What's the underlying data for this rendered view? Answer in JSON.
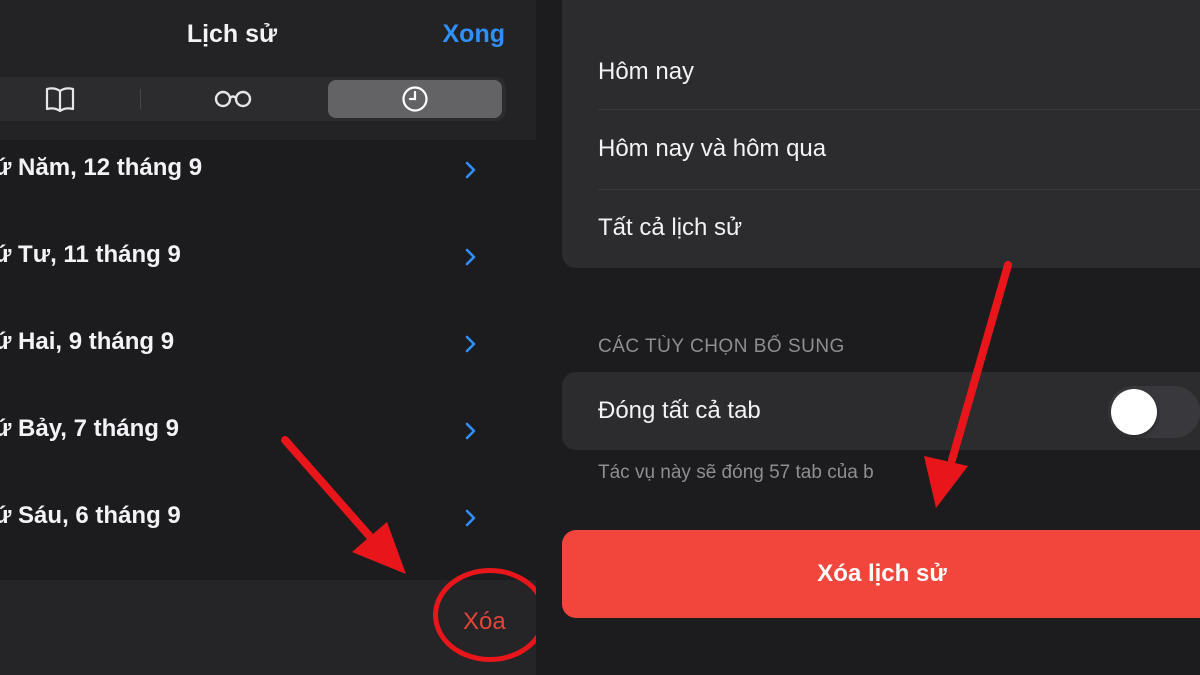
{
  "left_panel": {
    "title": "Lịch sử",
    "done_label": "Xong",
    "segments": [
      {
        "icon": "book-icon",
        "selected": false
      },
      {
        "icon": "reading-glasses-icon",
        "selected": false
      },
      {
        "icon": "clock-icon",
        "selected": true
      }
    ],
    "history_days": [
      {
        "label": "ứ Năm, 12 tháng 9"
      },
      {
        "label": "ứ Tư, 11 tháng 9"
      },
      {
        "label": "ứ Hai, 9 tháng 9"
      },
      {
        "label": "ứ Bảy, 7 tháng 9"
      },
      {
        "label": "ứ Sáu, 6 tháng 9"
      }
    ],
    "delete_label": "Xóa"
  },
  "right_panel": {
    "time_range_options": [
      {
        "label": "Hôm nay"
      },
      {
        "label": "Hôm nay và hôm qua"
      },
      {
        "label": "Tất cả lịch sử"
      }
    ],
    "additional_options_header": "CÁC TÙY CHỌN BỐ SUNG",
    "close_all_tabs_label": "Đóng tất cả tab",
    "close_all_tabs_enabled": false,
    "close_all_tabs_note": "Tác vụ này sẽ đóng 57 tab của b",
    "clear_history_label": "Xóa lịch sử"
  },
  "colors": {
    "accent_blue": "#2f8fff",
    "destructive_red": "#f2453b",
    "annotation_red": "#e8161b"
  }
}
